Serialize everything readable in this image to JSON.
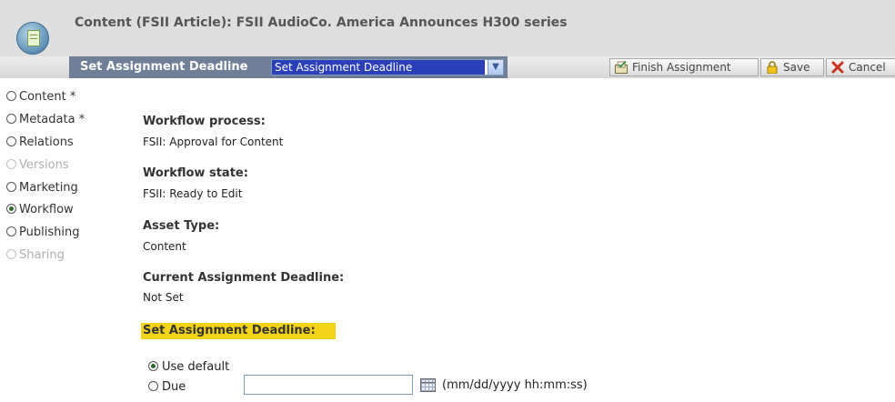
{
  "header": {
    "title": "Content (FSII Article): FSII AudioCo. America Announces H300 series"
  },
  "toolbar": {
    "step_label": "Set Assignment Deadline",
    "step_select_value": "Set Assignment Deadline",
    "finish_label": "Finish Assignment",
    "save_label": "Save",
    "cancel_label": "Cancel"
  },
  "sidebar": {
    "items": [
      {
        "label": "Content *",
        "state": "enabled"
      },
      {
        "label": "Metadata *",
        "state": "enabled"
      },
      {
        "label": "Relations",
        "state": "enabled"
      },
      {
        "label": "Versions",
        "state": "disabled"
      },
      {
        "label": "Marketing",
        "state": "enabled"
      },
      {
        "label": "Workflow",
        "state": "selected"
      },
      {
        "label": "Publishing",
        "state": "enabled"
      },
      {
        "label": "Sharing",
        "state": "disabled"
      }
    ]
  },
  "main": {
    "workflow_process_label": "Workflow process:",
    "workflow_process_value": "FSII: Approval for Content",
    "workflow_state_label": "Workflow state:",
    "workflow_state_value": "FSII: Ready to Edit",
    "asset_type_label": "Asset Type:",
    "asset_type_value": "Content",
    "current_deadline_label": "Current Assignment Deadline:",
    "current_deadline_value": "Not Set",
    "set_deadline_heading": "Set Assignment Deadline:",
    "use_default_label": "Use default",
    "due_label": "Due",
    "due_value": "",
    "date_format_hint": "(mm/dd/yyyy hh:mm:ss)"
  },
  "colors": {
    "toolbar_blue": "#6e7f97",
    "highlight_yellow": "#f3d31a",
    "select_highlight": "#2a3fb8"
  },
  "icons": [
    "content-asset-icon",
    "finish-assignment-icon",
    "lock-icon",
    "cancel-x-icon",
    "calendar-icon",
    "dropdown-arrow-icon"
  ]
}
